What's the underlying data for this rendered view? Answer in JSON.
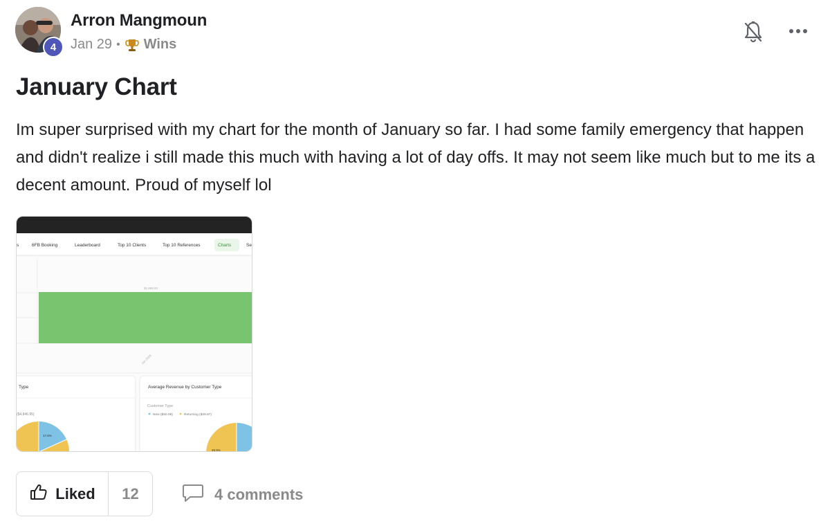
{
  "post": {
    "author": "Arron Mangmoun",
    "level": "4",
    "date": "Jan 29",
    "separator": "•",
    "category": "Wins",
    "category_icon": "trophy-icon",
    "title": "January Chart",
    "body": "Im super surprised with my chart for the month of January so far. I had some family emergency that happen and didn't realize i still made this much with having a lot of day offs. It may not seem like much but to me its a decent amount. Proud of myself lol"
  },
  "header_actions": {
    "notify_icon": "bell-off-icon",
    "more_icon": "more-dots-icon"
  },
  "attachment": {
    "tabs": [
      "s",
      "6FB Booking",
      "Leaderboard",
      "Top 10 Clients",
      "Top 10 References",
      "Charts",
      "Se"
    ],
    "active_tab": "Charts",
    "bar_value_label": "$1,898.93",
    "bar_x_label": "Jan 2026",
    "left_card_title": "Type",
    "left_card_value": "($4,846.95)",
    "left_pie_label": "17.8%",
    "right_card_title": "Average Revenue by Customer Type",
    "right_card_legend_title": "Customer Type",
    "right_card_legend_new": "New ($50.08)",
    "right_card_legend_returning": "Returning ($49.87)",
    "right_pie_label": "49.9%",
    "colors": {
      "bar": "#79c46e",
      "pie_blue": "#7ec3e6",
      "pie_yellow": "#f0c453",
      "topbar": "#232323"
    }
  },
  "actions": {
    "like_label": "Liked",
    "like_count": "12",
    "like_icon": "thumbs-up-icon",
    "comments_label": "4 comments",
    "comments_icon": "comment-icon"
  }
}
